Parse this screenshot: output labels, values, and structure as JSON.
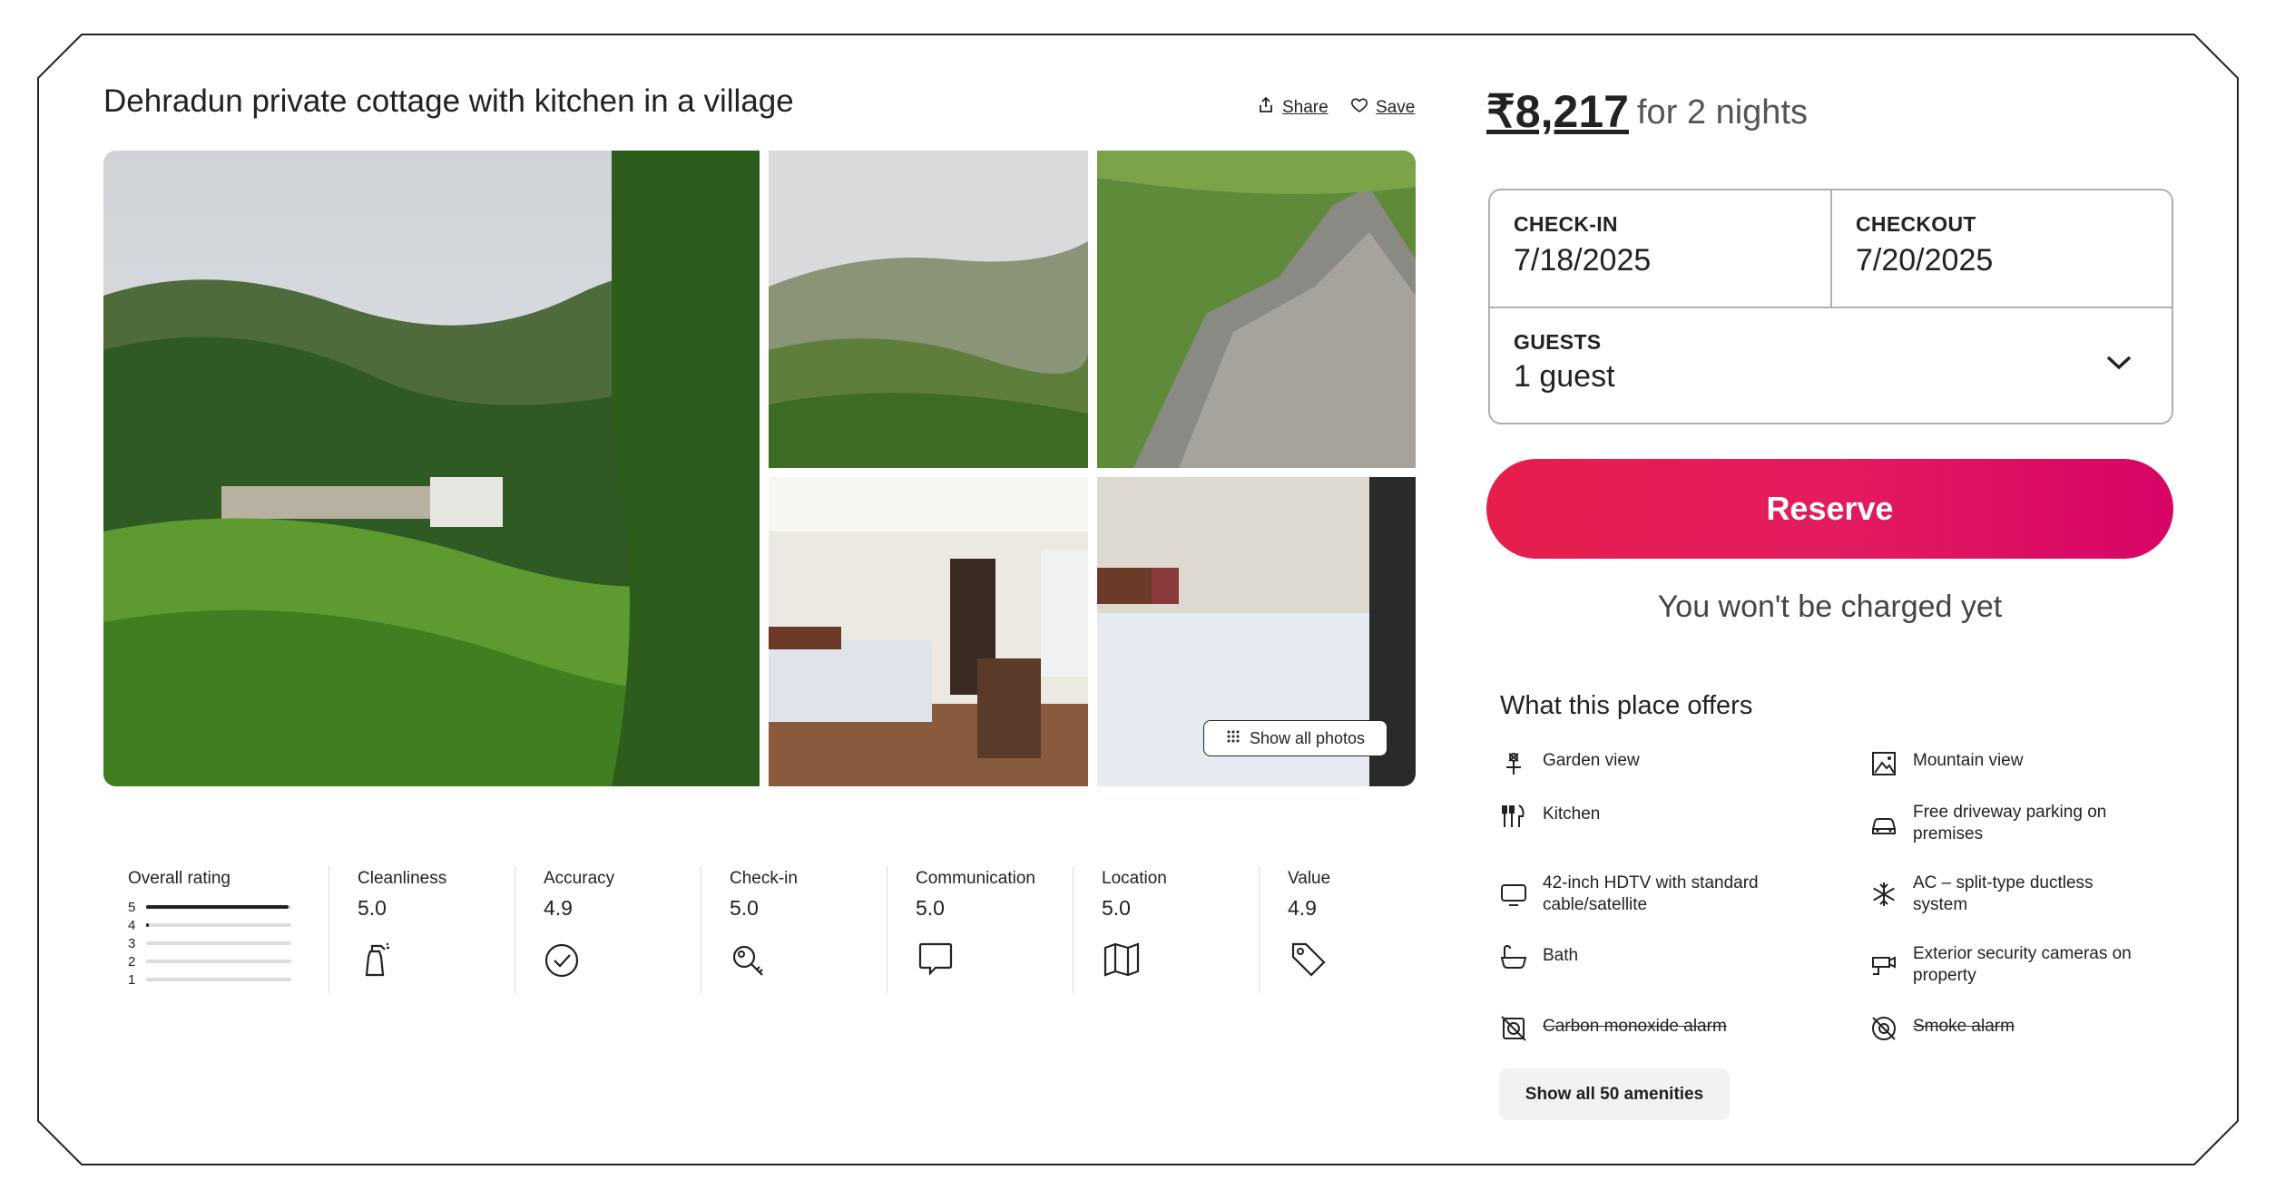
{
  "listing": {
    "title": "Dehradun private cottage with kitchen in a village",
    "share_label": "Share",
    "save_label": "Save",
    "show_all_photos_label": "Show all photos"
  },
  "pricing": {
    "price": "₹8,217",
    "suffix": "for 2 nights"
  },
  "booking": {
    "checkin_label": "CHECK-IN",
    "checkin_value": "7/18/2025",
    "checkout_label": "CHECKOUT",
    "checkout_value": "7/20/2025",
    "guests_label": "GUESTS",
    "guests_value": "1 guest",
    "reserve_label": "Reserve",
    "note": "You won't be charged yet"
  },
  "offers": {
    "heading": "What this place offers",
    "items": [
      {
        "label": "Garden view",
        "icon": "garden-icon",
        "available": true
      },
      {
        "label": "Mountain view",
        "icon": "mountain-icon",
        "available": true
      },
      {
        "label": "Kitchen",
        "icon": "kitchen-icon",
        "available": true
      },
      {
        "label": "Free driveway parking on premises",
        "icon": "car-icon",
        "available": true
      },
      {
        "label": "42-inch HDTV with standard cable/satellite",
        "icon": "tv-icon",
        "available": true
      },
      {
        "label": "AC – split-type ductless system",
        "icon": "snowflake-icon",
        "available": true
      },
      {
        "label": "Bath",
        "icon": "bathtub-icon",
        "available": true
      },
      {
        "label": "Exterior security cameras on property",
        "icon": "camera-icon",
        "available": true
      },
      {
        "label": "Carbon monoxide alarm",
        "icon": "co-alarm-icon",
        "available": false
      },
      {
        "label": "Smoke alarm",
        "icon": "smoke-alarm-icon",
        "available": false
      }
    ],
    "show_all_label": "Show all 50 amenities"
  },
  "ratings": {
    "overall_label": "Overall rating",
    "overall_bars": [
      {
        "stars": "5",
        "fraction": 0.98
      },
      {
        "stars": "4",
        "fraction": 0.02
      },
      {
        "stars": "3",
        "fraction": 0
      },
      {
        "stars": "2",
        "fraction": 0
      },
      {
        "stars": "1",
        "fraction": 0
      }
    ],
    "categories": [
      {
        "label": "Cleanliness",
        "value": "5.0",
        "icon": "spray-bottle-icon"
      },
      {
        "label": "Accuracy",
        "value": "4.9",
        "icon": "check-circle-icon"
      },
      {
        "label": "Check-in",
        "value": "5.0",
        "icon": "key-icon"
      },
      {
        "label": "Communication",
        "value": "5.0",
        "icon": "chat-bubble-icon"
      },
      {
        "label": "Location",
        "value": "5.0",
        "icon": "map-icon"
      },
      {
        "label": "Value",
        "value": "4.9",
        "icon": "price-tag-icon"
      }
    ]
  },
  "colors": {
    "reserve_start": "#e61e4d",
    "reserve_end": "#d70466",
    "text": "#222222",
    "border": "#b0b0b0"
  }
}
